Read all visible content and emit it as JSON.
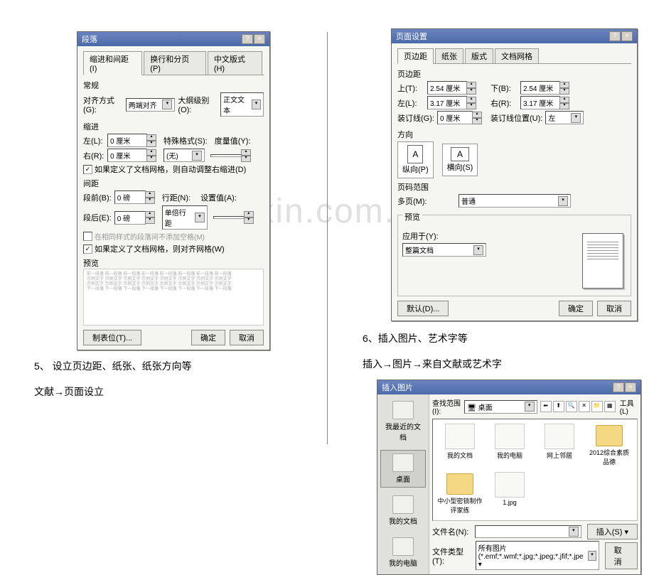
{
  "watermark": "www.zixin.com.cn",
  "paragraph_dialog": {
    "title": "段落",
    "tabs": [
      "缩进和间距(I)",
      "换行和分页(P)",
      "中文版式(H)"
    ],
    "general_group": "常规",
    "align_label": "对齐方式(G):",
    "align_value": "两端对齐",
    "outline_label": "大纲级别(O):",
    "outline_value": "正文文本",
    "indent_group": "缩进",
    "left_label": "左(L):",
    "left_value": "0 厘米",
    "right_label": "右(R):",
    "right_value": "0 厘米",
    "special_label": "特殊格式(S):",
    "special_value": "(无)",
    "measure_label": "度量值(Y):",
    "auto_indent_chk": "如果定义了文档网格，则自动调整右缩进(D)",
    "spacing_group": "间距",
    "before_label": "段前(B):",
    "before_value": "0 磅",
    "after_label": "段后(E):",
    "after_value": "0 磅",
    "line_label": "行距(N):",
    "line_value": "单倍行距",
    "setvalue_label": "设置值(A):",
    "same_style_chk": "在相同样式的段落间不添加空格(M)",
    "snap_grid_chk": "如果定义了文档网格，则对齐网格(W)",
    "preview_group": "预览",
    "tabs_btn": "制表位(T)...",
    "ok": "确定",
    "cancel": "取消"
  },
  "left_texts": {
    "step5": "5、 设立页边距、纸张、纸张方向等",
    "step5b": "文献→页面设立"
  },
  "page_setup_dialog": {
    "title": "页面设置",
    "tabs": [
      "页边距",
      "纸张",
      "版式",
      "文档网格"
    ],
    "margins_group": "页边距",
    "top_label": "上(T):",
    "top_value": "2.54 厘米",
    "bottom_label": "下(B):",
    "bottom_value": "2.54 厘米",
    "left_label": "左(L):",
    "left_value": "3.17 厘米",
    "right_label": "右(R):",
    "right_value": "3.17 厘米",
    "gutter_label": "装订线(G):",
    "gutter_value": "0 厘米",
    "gutter_pos_label": "装订线位置(U):",
    "gutter_pos_value": "左",
    "orient_group": "方向",
    "portrait": "纵向(P)",
    "landscape": "横向(S)",
    "pages_group": "页码范围",
    "multi_label": "多页(M):",
    "multi_value": "普通",
    "preview_group": "预览",
    "apply_label": "应用于(Y):",
    "apply_value": "整篇文档",
    "default_btn": "默认(D)...",
    "ok": "确定",
    "cancel": "取消"
  },
  "right_texts": {
    "step6": "6、插入图片、艺术字等",
    "step6b": "插入→图片→来自文献或艺术字"
  },
  "insert_pic_dialog": {
    "title": "插入图片",
    "lookin_label": "查找范围(I):",
    "lookin_value": "桌面",
    "tools_label": "工具(L)",
    "places": [
      "我最近的文档",
      "桌面",
      "我的文档",
      "我的电脑"
    ],
    "files": {
      "r1": [
        "我的文档",
        "我的电脑",
        "网上邻居"
      ],
      "r2": [
        "2012综合素质品德",
        "中小型密锁制作评家练",
        "1.jpg"
      ]
    },
    "filename_label": "文件名(N):",
    "filename_value": "",
    "filetype_label": "文件类型(T):",
    "filetype_value": "所有图片(*.emf;*.wmf;*.jpg;*.jpeg;*.jfif;*.jpe ▾",
    "insert_btn": "插入(S)",
    "cancel": "取消"
  }
}
